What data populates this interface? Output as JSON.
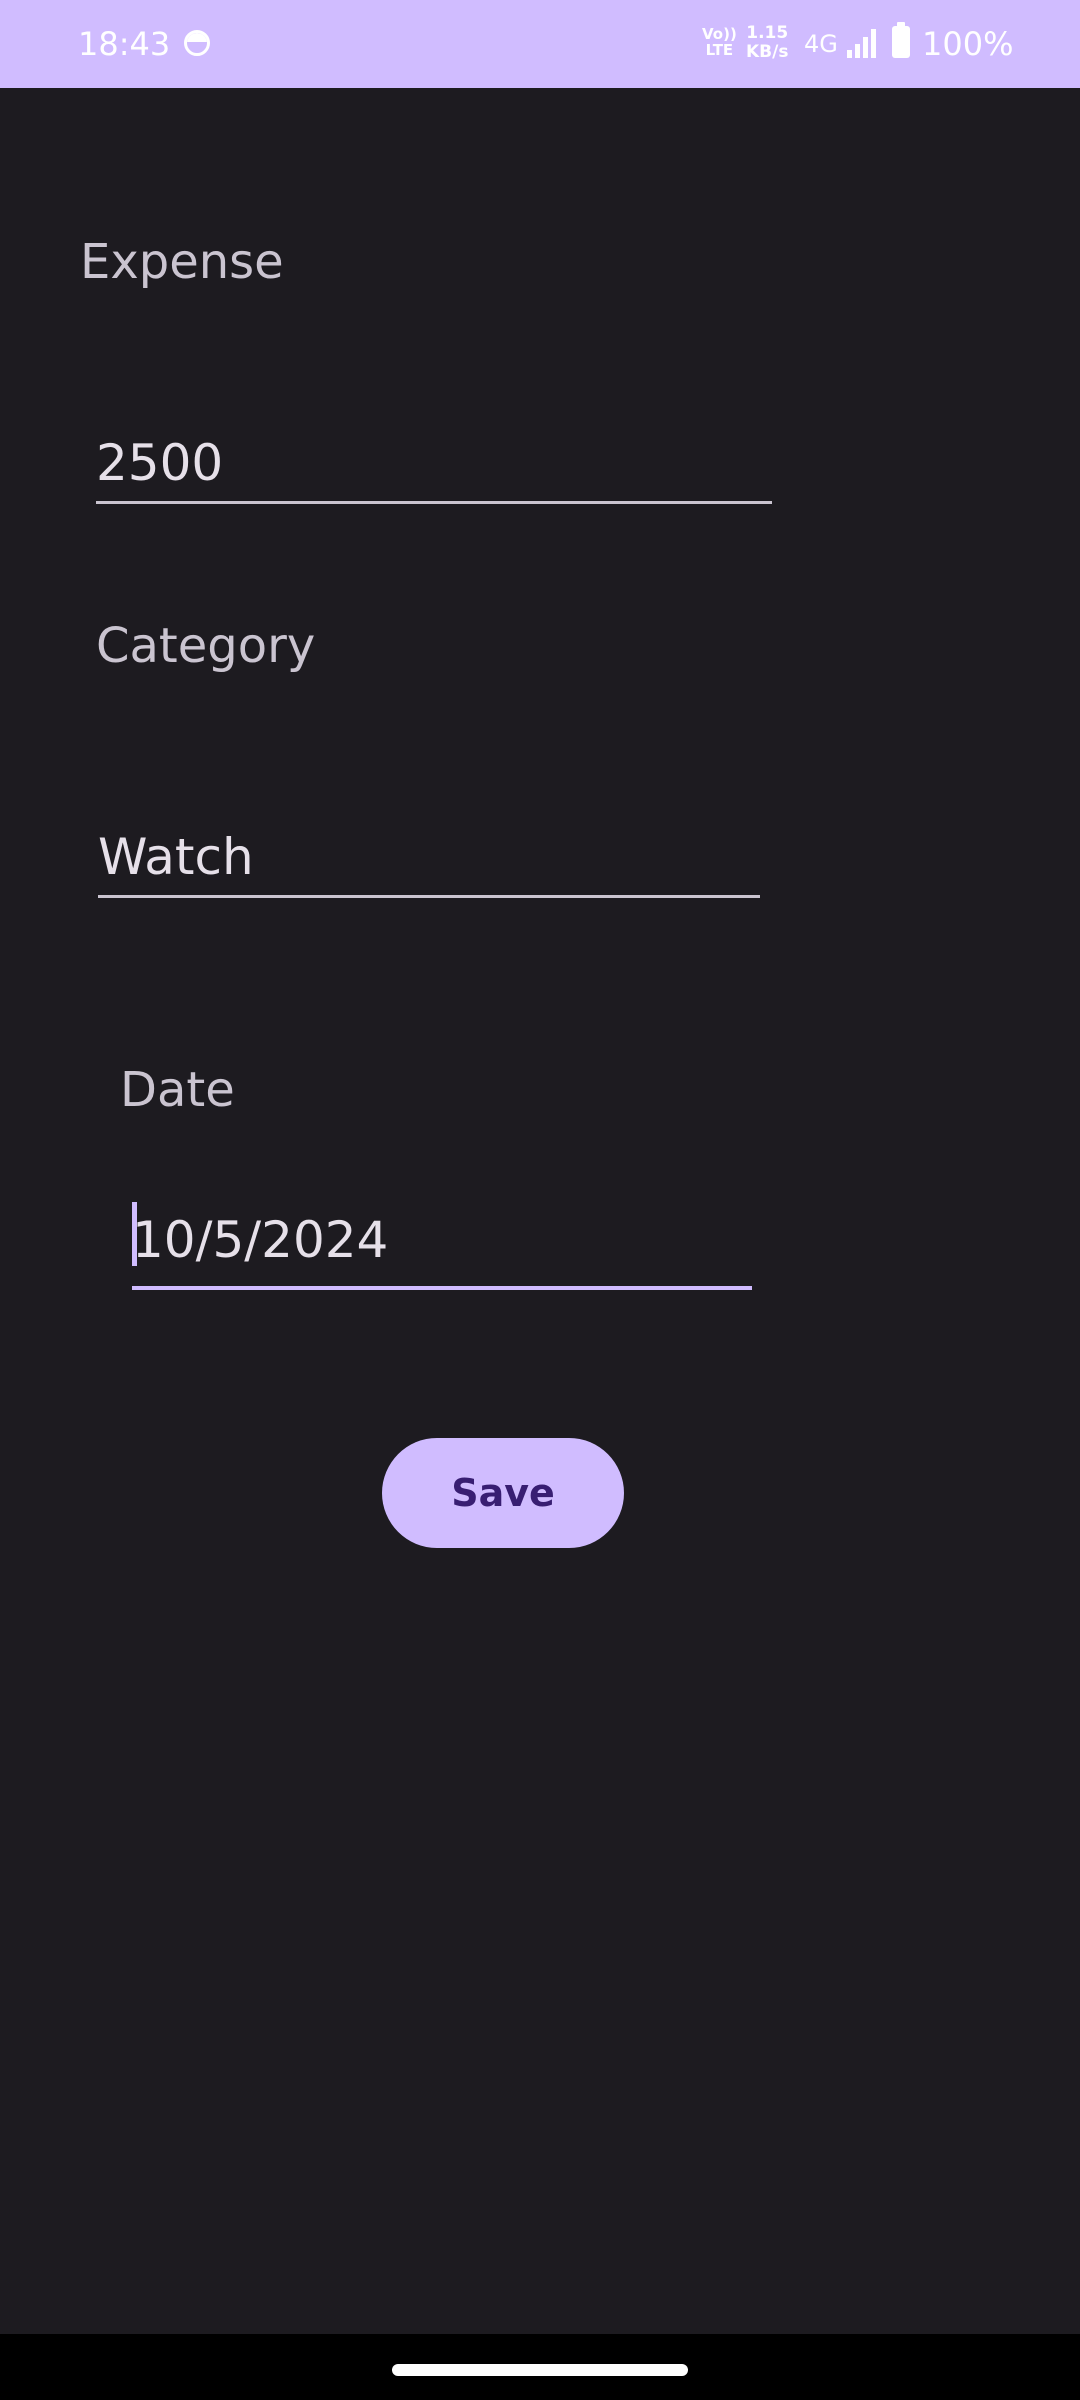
{
  "status_bar": {
    "time": "18:43",
    "volte_top": "Vo))",
    "volte_bottom": "LTE",
    "speed_value": "1.15",
    "speed_unit": "KB/s",
    "network": "4G",
    "battery": "100%",
    "app_icon": "notification-app-icon",
    "signal_icon": "signal-strength-icon",
    "battery_icon": "battery-full-icon"
  },
  "form": {
    "expense_label": "Expense",
    "expense_value": "2500",
    "category_label": "Category",
    "category_value": "Watch",
    "date_label": "Date",
    "date_value": "10/5/2024",
    "save_label": "Save"
  },
  "colors": {
    "background": "#1d1b20",
    "accent": "#d0bcff",
    "button_text": "#381e72",
    "text": "#e6e0e9",
    "label": "#cac4d0"
  }
}
